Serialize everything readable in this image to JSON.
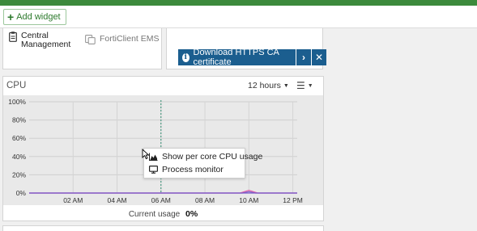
{
  "topbar": {
    "color": "#3c8a3c"
  },
  "toolbar": {
    "add_widget_label": "Add widget",
    "add_widget_icon": "plus-icon"
  },
  "fabric": {
    "central_management": "Central\nManagement",
    "central_management_icon": "clipboard-icon",
    "forticlient_ems": "FortiClient EMS",
    "forticlient_ems_icon": "ems-icon"
  },
  "notice": {
    "label": "Download HTTPS CA certificate",
    "info_icon": "info-icon",
    "next_icon": "chevron-right-icon",
    "close_icon": "close-icon",
    "color": "#1b5e8f"
  },
  "cpu_widget": {
    "title": "CPU",
    "time_range": "12 hours",
    "menu_icon": "hamburger-icon",
    "current_usage_label": "Current usage",
    "current_usage_value": "0%"
  },
  "context_menu": {
    "items": [
      {
        "label": "Show per core CPU usage",
        "icon": "area-chart-icon"
      },
      {
        "label": "Process monitor",
        "icon": "monitor-icon"
      }
    ]
  },
  "chart_data": {
    "type": "line",
    "y_ticks": [
      "100%",
      "80%",
      "60%",
      "40%",
      "20%",
      "0%"
    ],
    "x_ticks": [
      "02 AM",
      "04 AM",
      "06 AM",
      "08 AM",
      "10 AM",
      "12 PM"
    ],
    "ylim": [
      0,
      100
    ],
    "grid": true,
    "series": [
      {
        "color": "#e05aa8",
        "x": [
          0,
          9.6,
          10.0,
          10.4,
          12.2
        ],
        "y": [
          0,
          0,
          3,
          0,
          0
        ]
      },
      {
        "color": "#7b5cc9",
        "x": [
          0,
          9.7,
          10.0,
          10.3,
          12.2
        ],
        "y": [
          0,
          0,
          1.5,
          0,
          0
        ]
      }
    ],
    "hover_x": 6.0
  }
}
